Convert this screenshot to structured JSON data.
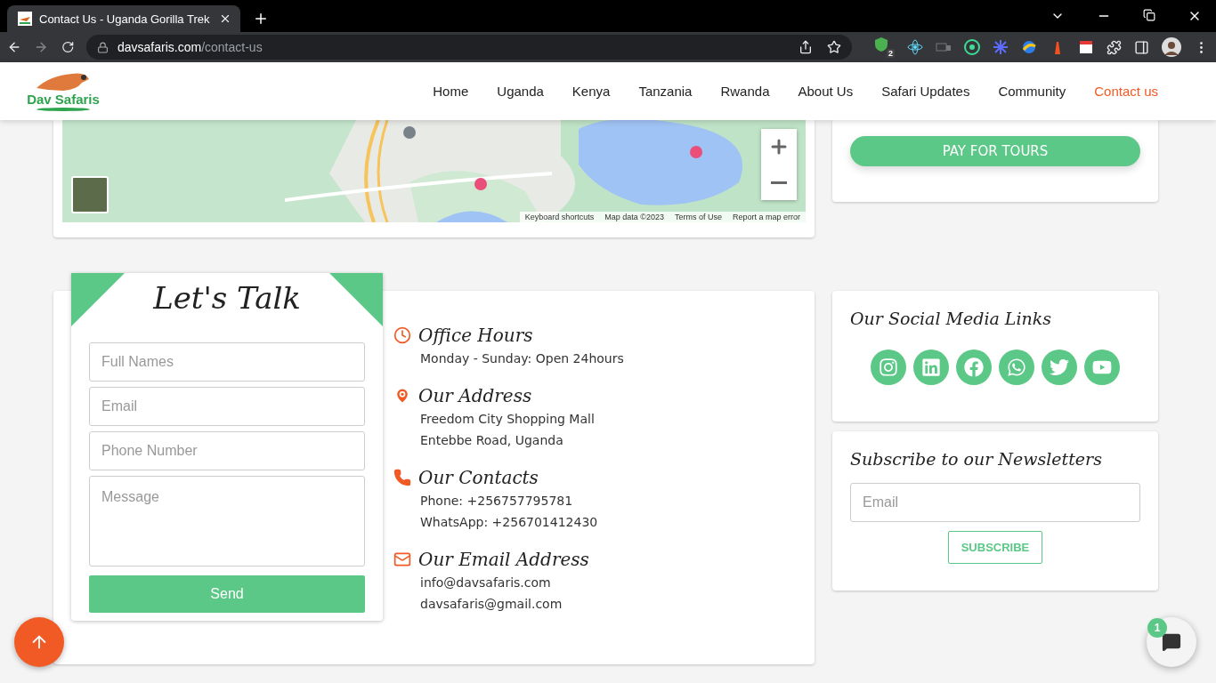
{
  "browser": {
    "tab_title": "Contact Us - Uganda Gorilla Trek",
    "url_domain": "davsafaris.com",
    "url_path": "/contact-us",
    "extension_badge": "2"
  },
  "site": {
    "logo_text": "Dav Safaris",
    "nav": [
      {
        "label": "Home",
        "selected": false
      },
      {
        "label": "Uganda",
        "selected": false
      },
      {
        "label": "Kenya",
        "selected": false
      },
      {
        "label": "Tanzania",
        "selected": false
      },
      {
        "label": "Rwanda",
        "selected": false
      },
      {
        "label": "About Us",
        "selected": false
      },
      {
        "label": "Safari Updates",
        "selected": false
      },
      {
        "label": "Community",
        "selected": false
      },
      {
        "label": "Contact us",
        "selected": true
      }
    ]
  },
  "map": {
    "attribution": [
      "Keyboard shortcuts",
      "Map data ©2023",
      "Terms of Use",
      "Report a map error"
    ]
  },
  "pay_button": "PAY FOR TOURS",
  "form": {
    "title": "Let's Talk",
    "fields": [
      {
        "kind": "input",
        "placeholder": "Full Names"
      },
      {
        "kind": "input",
        "placeholder": "Email"
      },
      {
        "kind": "input",
        "placeholder": "Phone Number"
      },
      {
        "kind": "textarea",
        "placeholder": "Message"
      }
    ],
    "submit": "Send"
  },
  "info": [
    {
      "kind": "hours",
      "heading": "Office Hours",
      "lines": [
        "Monday - Sunday: Open 24hours"
      ]
    },
    {
      "kind": "address",
      "heading": "Our Address",
      "lines": [
        "Freedom City Shopping Mall",
        "Entebbe Road, Uganda"
      ]
    },
    {
      "kind": "phone",
      "heading": "Our Contacts",
      "lines": [
        "Phone: +256757795781",
        "WhatsApp: +256701412430"
      ]
    },
    {
      "kind": "email",
      "heading": "Our Email Address",
      "lines": [
        "info@davsafaris.com",
        "davsafaris@gmail.com"
      ]
    }
  ],
  "social": {
    "title": "Our Social Media Links",
    "links": [
      {
        "kind": "instagram"
      },
      {
        "kind": "linkedin"
      },
      {
        "kind": "facebook"
      },
      {
        "kind": "whatsapp"
      },
      {
        "kind": "twitter"
      },
      {
        "kind": "youtube"
      }
    ]
  },
  "newsletter": {
    "title": "Subscribe to our Newsletters",
    "placeholder": "Email",
    "button": "SUBSCRIBE"
  },
  "chat": {
    "badge": "1"
  }
}
